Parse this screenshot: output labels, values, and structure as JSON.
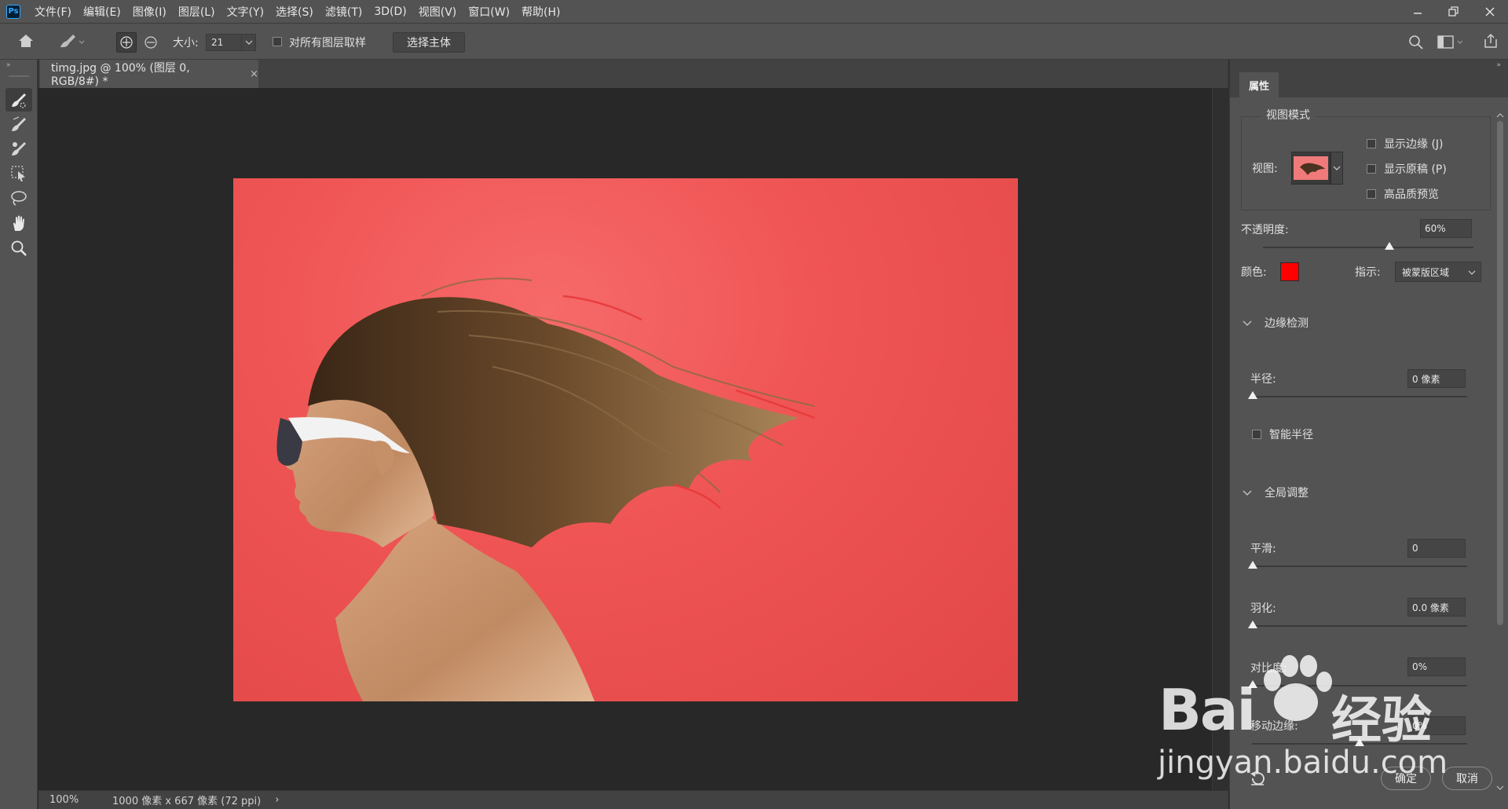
{
  "app": {
    "logo": "Ps"
  },
  "menu": [
    "文件(F)",
    "编辑(E)",
    "图像(I)",
    "图层(L)",
    "文字(Y)",
    "选择(S)",
    "滤镜(T)",
    "3D(D)",
    "视图(V)",
    "窗口(W)",
    "帮助(H)"
  ],
  "options": {
    "size_label": "大小:",
    "size_value": "21",
    "sample_all_layers": "对所有图层取样",
    "select_subject": "选择主体"
  },
  "document": {
    "tab_title": "timg.jpg @ 100% (图层 0, RGB/8#) *",
    "close": "×"
  },
  "status": {
    "zoom": "100%",
    "info": "1000 像素 x 667 像素 (72 ppi)",
    "arrow": "›"
  },
  "panel": {
    "tab": "属性",
    "view_mode_title": "视图模式",
    "view_label": "视图:",
    "show_edge": "显示边缘 (J)",
    "show_original": "显示原稿 (P)",
    "hq_preview": "高品质预览",
    "opacity_label": "不透明度:",
    "opacity_value": "60%",
    "opacity_level": 0.6,
    "color_label": "颜色:",
    "color_swatch": "#ff0000",
    "indicate_label": "指示:",
    "indicate_value": "被蒙版区域",
    "edge_detection": "边缘检测",
    "radius_label": "半径:",
    "radius_value": "0 像素",
    "smart_radius": "智能半径",
    "global_refine": "全局调整",
    "smooth_label": "平滑:",
    "smooth_value": "0",
    "feather_label": "羽化:",
    "feather_value": "0.0 像素",
    "contrast_label": "对比度:",
    "contrast_value": "0%",
    "shift_edge_label": "移动边缘:",
    "shift_edge_value": "0%",
    "ok": "确定",
    "cancel": "取消"
  },
  "watermark": {
    "brand": "Bai",
    "brand_cn": "经验",
    "url": "jingyan.baidu.com"
  }
}
